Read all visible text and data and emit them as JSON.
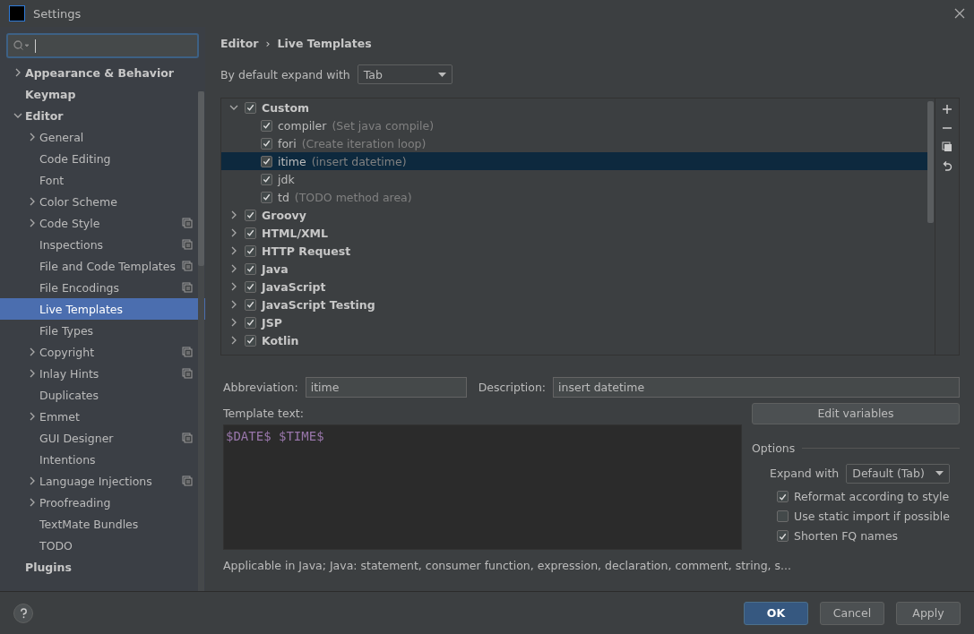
{
  "window": {
    "title": "Settings"
  },
  "sidebar": {
    "items": [
      {
        "label": "Appearance & Behavior",
        "kind": "folder",
        "expanded": false,
        "selected": false,
        "project_level": false
      },
      {
        "label": "Keymap",
        "kind": "page",
        "selected": false,
        "project_level": false
      },
      {
        "label": "Editor",
        "kind": "folder",
        "expanded": true,
        "selected": false,
        "project_level": false,
        "children": [
          {
            "label": "General",
            "kind": "folder",
            "expanded": false,
            "selected": false,
            "project_level": false
          },
          {
            "label": "Code Editing",
            "kind": "page",
            "selected": false,
            "project_level": false
          },
          {
            "label": "Font",
            "kind": "page",
            "selected": false,
            "project_level": false
          },
          {
            "label": "Color Scheme",
            "kind": "folder",
            "expanded": false,
            "selected": false,
            "project_level": false
          },
          {
            "label": "Code Style",
            "kind": "folder",
            "expanded": false,
            "selected": false,
            "project_level": true
          },
          {
            "label": "Inspections",
            "kind": "page",
            "selected": false,
            "project_level": true
          },
          {
            "label": "File and Code Templates",
            "kind": "page",
            "selected": false,
            "project_level": true
          },
          {
            "label": "File Encodings",
            "kind": "page",
            "selected": false,
            "project_level": true
          },
          {
            "label": "Live Templates",
            "kind": "page",
            "selected": true,
            "project_level": false
          },
          {
            "label": "File Types",
            "kind": "page",
            "selected": false,
            "project_level": false
          },
          {
            "label": "Copyright",
            "kind": "folder",
            "expanded": false,
            "selected": false,
            "project_level": true
          },
          {
            "label": "Inlay Hints",
            "kind": "folder",
            "expanded": false,
            "selected": false,
            "project_level": true
          },
          {
            "label": "Duplicates",
            "kind": "page",
            "selected": false,
            "project_level": false
          },
          {
            "label": "Emmet",
            "kind": "folder",
            "expanded": false,
            "selected": false,
            "project_level": false
          },
          {
            "label": "GUI Designer",
            "kind": "page",
            "selected": false,
            "project_level": true
          },
          {
            "label": "Intentions",
            "kind": "page",
            "selected": false,
            "project_level": false
          },
          {
            "label": "Language Injections",
            "kind": "folder",
            "expanded": false,
            "selected": false,
            "project_level": true
          },
          {
            "label": "Proofreading",
            "kind": "folder",
            "expanded": false,
            "selected": false,
            "project_level": false
          },
          {
            "label": "TextMate Bundles",
            "kind": "page",
            "selected": false,
            "project_level": false
          },
          {
            "label": "TODO",
            "kind": "page",
            "selected": false,
            "project_level": false
          }
        ]
      },
      {
        "label": "Plugins",
        "kind": "page",
        "selected": false,
        "project_level": false
      }
    ]
  },
  "breadcrumb": [
    "Editor",
    "›",
    "Live Templates"
  ],
  "expand_default": {
    "label": "By default expand with",
    "value": "Tab"
  },
  "templates": [
    {
      "name": "Custom",
      "expanded": true,
      "checked": true,
      "children": [
        {
          "abbreviation": "compiler",
          "description": "(Set java compile)",
          "checked": true,
          "selected": false
        },
        {
          "abbreviation": "fori",
          "description": "(Create iteration loop)",
          "checked": true,
          "selected": false
        },
        {
          "abbreviation": "itime",
          "description": "(insert datetime)",
          "checked": true,
          "selected": true
        },
        {
          "abbreviation": "jdk",
          "checked": true,
          "selected": false
        },
        {
          "abbreviation": "td",
          "description": "(TODO method area)",
          "checked": true,
          "selected": false
        }
      ]
    },
    {
      "name": "Groovy",
      "expanded": false,
      "checked": true
    },
    {
      "name": "HTML/XML",
      "expanded": false,
      "checked": true
    },
    {
      "name": "HTTP Request",
      "expanded": false,
      "checked": true
    },
    {
      "name": "Java",
      "expanded": false,
      "checked": true
    },
    {
      "name": "JavaScript",
      "expanded": false,
      "checked": true
    },
    {
      "name": "JavaScript Testing",
      "expanded": false,
      "checked": true
    },
    {
      "name": "JSP",
      "expanded": false,
      "checked": true
    },
    {
      "name": "Kotlin",
      "expanded": false,
      "checked": true
    }
  ],
  "form": {
    "abbreviation_label": "Abbreviation:",
    "abbreviation": "itime",
    "description_label": "Description:",
    "description": "insert datetime",
    "template_label": "Template text:",
    "template_text": "$DATE$ $TIME$",
    "edit_variables": "Edit variables",
    "applicable": "Applicable in Java; Java: statement, consumer function, expression, declaration, comment, string, s...",
    "options": {
      "title": "Options",
      "expand_label": "Expand with",
      "expand_value": "Default (Tab)",
      "checks": [
        {
          "label": "Reformat according to style",
          "checked": true
        },
        {
          "label": "Use static import if possible",
          "checked": false
        },
        {
          "label": "Shorten FQ names",
          "checked": true
        }
      ]
    }
  },
  "buttons": [
    {
      "label": "OK",
      "kind": "primary"
    },
    {
      "label": "Cancel",
      "kind": "normal"
    },
    {
      "label": "Apply",
      "kind": "normal"
    }
  ]
}
